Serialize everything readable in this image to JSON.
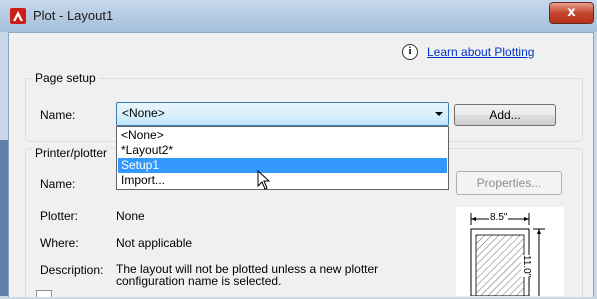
{
  "window": {
    "title": "Plot - Layout1",
    "close_label": "x"
  },
  "help": {
    "info_glyph": "i",
    "learn_link": "Learn about Plotting"
  },
  "page_setup": {
    "group_label": "Page setup",
    "name_label": "Name:",
    "selected_value": "<None>",
    "add_button": "Add...",
    "options": [
      "<None>",
      "*Layout2*",
      "Setup1",
      "Import..."
    ],
    "highlighted_option": "Setup1"
  },
  "printer": {
    "group_label": "Printer/plotter",
    "name_label": "Name:",
    "properties_button": "Properties...",
    "plotter_label": "Plotter:",
    "plotter_value": "None",
    "where_label": "Where:",
    "where_value": "Not applicable",
    "description_label": "Description:",
    "description_value": "The layout will not be plotted unless a new plotter configuration name is selected."
  },
  "preview": {
    "width_label": "8.5\"",
    "height_label": "11.0\""
  },
  "colors": {
    "accent_selection": "#3399ff",
    "link": "#0033cc",
    "close_button": "#c5462f",
    "acad_logo": "#d42a1f"
  }
}
